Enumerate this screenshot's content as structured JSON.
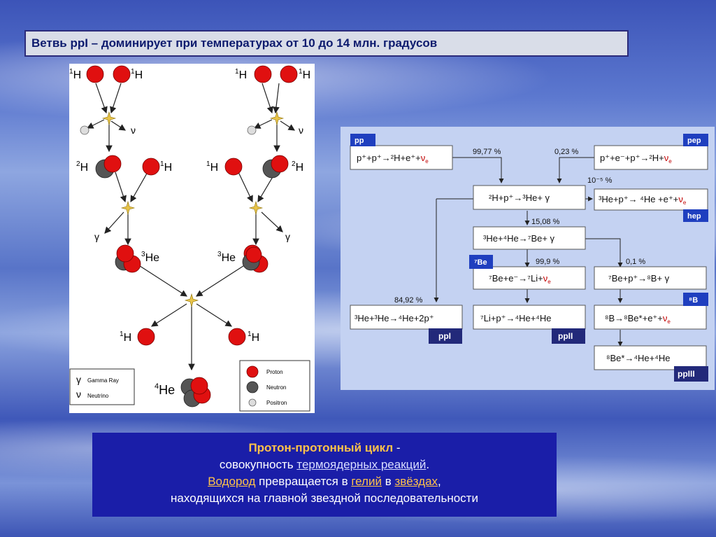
{
  "title": "Ветвь ppI – доминирует при температурах  от 10 до 14 млн. градусов",
  "left_diagram": {
    "h1": "H",
    "h1_sup": "1",
    "h2": "H",
    "h2_sup": "2",
    "he3": "He",
    "he3_sup": "3",
    "he4": "He",
    "he4_sup": "4",
    "gamma": "γ",
    "nu": "ν",
    "legend_left": {
      "gamma_label": "Gamma Ray",
      "nu_label": "Neutrino"
    },
    "legend_right": {
      "proton": "Proton",
      "neutron": "Neutron",
      "positron": "Positron"
    },
    "colors": {
      "proton": "#e01010",
      "neutron": "#555555",
      "positron": "#dddddd"
    }
  },
  "right_diagram": {
    "tags": {
      "pp": "pp",
      "pep": "pep",
      "hep": "hep",
      "be7": "⁷Be",
      "b8": "⁸B",
      "ppI": "ppI",
      "ppII": "ppII",
      "ppIII": "ppIII"
    },
    "percents": {
      "p9977": "99,77 %",
      "p023": "0,23 %",
      "p10m5": "10⁻⁵ %",
      "p1508": "15,08 %",
      "p999": "99,9 %",
      "p01": "0,1 %",
      "p8492": "84,92 %"
    },
    "reactions": {
      "r_pp_a": "p⁺+p⁺→²H+e⁺+",
      "r_pp_b": "ν",
      "r_pp_c": "e",
      "r_pep_a": "p⁺+e⁻+p⁺→²H+",
      "r_pep_b": "ν",
      "r_pep_c": "e",
      "r_he3": "²H+p⁺→³He+ γ",
      "r_hep_a": "³He+p⁺→ ⁴He +e⁺+",
      "r_hep_b": "ν",
      "r_hep_c": "e",
      "r_be7": "³He+⁴He→⁷Be+ γ",
      "r_li7_a": "⁷Be+e⁻→⁷Li+",
      "r_li7_b": "ν",
      "r_li7_c": "e",
      "r_b8": "⁷Be+p⁺→⁸B+ γ",
      "r_ppi": "³He+³He→⁴He+2p⁺",
      "r_ppii": "⁷Li+p⁺→⁴He+⁴He",
      "r_be8_a": "⁸B→⁸Be*+e⁺+",
      "r_be8_b": "ν",
      "r_be8_c": "e",
      "r_ppiii": "⁸Be*→⁴He+⁴He"
    }
  },
  "info": {
    "line1_lead": "Протон-протонный цикл",
    "line1_rest": " -",
    "line2_pre": "совокупность ",
    "line2_link": "термоядерных реакций",
    "line2_post": ".",
    "line3_link1": "Водород",
    "line3_mid1": " превращается в ",
    "line3_link2": "гелий",
    "line3_mid2": " в ",
    "line3_link3": "звёздах",
    "line3_post": ",",
    "line4": "находящихся на главной звездной последовательности"
  }
}
